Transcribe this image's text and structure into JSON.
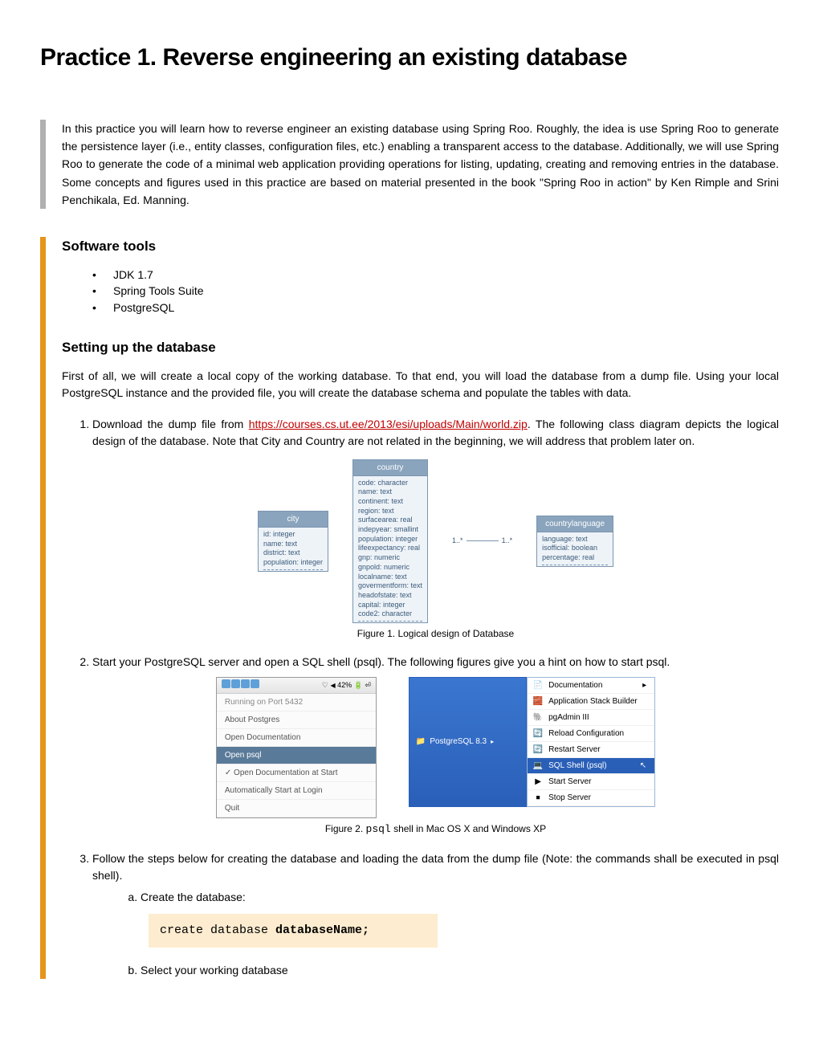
{
  "title": "Practice 1. Reverse engineering an existing database",
  "intro": "In this practice you will learn how to reverse engineer an existing database using Spring Roo. Roughly, the idea is use Spring Roo to generate the persistence layer (i.e., entity classes, configuration files, etc.) enabling a transparent access to the database. Additionally, we will use Spring Roo to generate the code of a minimal web application providing operations for listing, updating, creating and removing entries in the database. Some concepts and figures used in this practice are based on material presented in the book \"Spring Roo in action\" by Ken Rimple and Srini Penchikala, Ed. Manning.",
  "sections": {
    "software": {
      "heading": "Software tools",
      "items": [
        "JDK 1.7",
        "Spring Tools Suite",
        "PostgreSQL"
      ]
    },
    "setup": {
      "heading": "Setting up the database",
      "body": "First of all, we will create a local copy of the working database. To that end, you will load the database from a dump file. Using your local PostgreSQL instance and the provided file, you will create the database schema and populate the tables with data.",
      "step1a": "Download the dump file from ",
      "link": "https://courses.cs.ut.ee/2013/esi/uploads/Main/world.zip",
      "step1b": ". The following class diagram depicts the logical design of the database. Note that City and Country are not related in the beginning, we will address that problem later on.",
      "step2": "Start your PostgreSQL server and open a SQL shell (psql). The following figures give you a hint on how to start psql.",
      "step3": "Follow the steps below for creating the database and loading the data from the dump file (Note: the commands shall be executed in psql shell).",
      "sub_a": "Create the database:",
      "sub_b": "Select your working database",
      "code1a": "create database ",
      "code1b": "databaseName;"
    }
  },
  "erd": {
    "city": {
      "title": "city",
      "attrs": [
        "id: integer",
        "name: text",
        "district: text",
        "population: integer"
      ]
    },
    "country": {
      "title": "country",
      "attrs": [
        "code: character",
        "name: text",
        "continent: text",
        "region: text",
        "surfacearea: real",
        "indepyear: smallint",
        "population: integer",
        "lifeexpectancy: real",
        "gnp: numeric",
        "gnpold: numeric",
        "localname: text",
        "govermentform: text",
        "headofstate: text",
        "capital: integer",
        "code2: character"
      ]
    },
    "lang": {
      "title": "countrylanguage",
      "attrs": [
        "language: text",
        "isofficial: boolean",
        "percentage: real"
      ]
    },
    "rel_left": "1..*",
    "rel_right": "1..*"
  },
  "captions": {
    "fig1": "Figure 1. Logical design of Database",
    "fig2a": "Figure 2. ",
    "fig2code": "psql",
    "fig2b": " shell in Mac OS X and Windows XP"
  },
  "mac": {
    "status": "42%",
    "port": "Running on Port 5432",
    "about": "About Postgres",
    "docs": "Open Documentation",
    "open": "Open psql",
    "start_doc": "Open Documentation at Start",
    "auto": "Automatically Start at Login",
    "quit": "Quit"
  },
  "win": {
    "btn": "PostgreSQL 8.3",
    "items": [
      {
        "icon": "📄",
        "label": "Documentation",
        "tri": "▸"
      },
      {
        "icon": "🧱",
        "label": "Application Stack Builder"
      },
      {
        "icon": "🐘",
        "label": "pgAdmin III"
      },
      {
        "icon": "🔄",
        "label": "Reload Configuration"
      },
      {
        "icon": "🔄",
        "label": "Restart Server"
      },
      {
        "icon": "💻",
        "label": "SQL Shell (psql)",
        "sel": true
      },
      {
        "icon": "▶",
        "label": "Start Server"
      },
      {
        "icon": "⏹",
        "label": "Stop Server"
      }
    ]
  }
}
